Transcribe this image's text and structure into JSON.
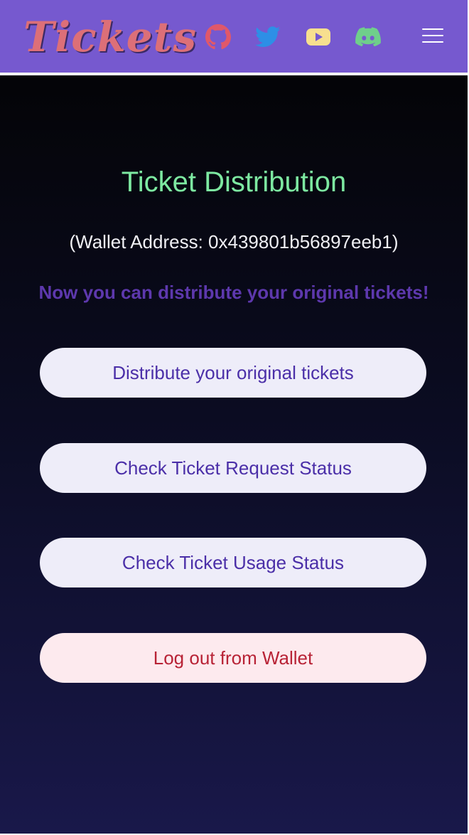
{
  "header": {
    "logo_text": "Tickets",
    "social_icons": [
      "github-icon",
      "twitter-icon",
      "youtube-icon",
      "discord-icon"
    ],
    "menu_icon": "hamburger-menu-icon"
  },
  "main": {
    "title": "Ticket Distribution",
    "wallet_address": "(Wallet Address: 0x439801b56897eeb1)",
    "subtitle": "Now you can distribute your original tickets!",
    "buttons": {
      "distribute": "Distribute your original tickets",
      "request_status": "Check Ticket Request Status",
      "usage_status": "Check Ticket Usage Status",
      "logout": "Log out from Wallet"
    }
  },
  "colors": {
    "header_bg": "#7659cf",
    "logo": "#dc6f78",
    "title": "#7de8a1",
    "subtitle": "#5d38ad",
    "button_bg": "#eeedf9",
    "button_text": "#4b2fa8",
    "logout_bg": "#fdeaee",
    "logout_text": "#b82336",
    "github_icon": "#e0586a",
    "twitter_icon": "#2d8fe6",
    "youtube_icon": "#f7df8f",
    "discord_icon": "#6fcf8b"
  }
}
